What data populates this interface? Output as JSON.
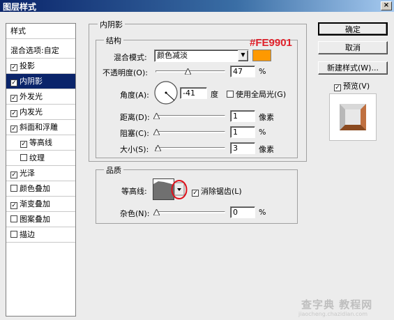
{
  "window": {
    "title": "图层样式",
    "close": "×"
  },
  "left_list": {
    "header": "样式",
    "items": [
      {
        "label": "混合选项:自定",
        "checkbox": false,
        "checked": false,
        "selected": false,
        "indent": false
      },
      {
        "label": "投影",
        "checkbox": true,
        "checked": true,
        "selected": false,
        "indent": false
      },
      {
        "label": "内阴影",
        "checkbox": true,
        "checked": true,
        "selected": true,
        "indent": false
      },
      {
        "label": "外发光",
        "checkbox": true,
        "checked": true,
        "selected": false,
        "indent": false
      },
      {
        "label": "内发光",
        "checkbox": true,
        "checked": true,
        "selected": false,
        "indent": false
      },
      {
        "label": "斜面和浮雕",
        "checkbox": true,
        "checked": true,
        "selected": false,
        "indent": false
      },
      {
        "label": "等高线",
        "checkbox": true,
        "checked": true,
        "selected": false,
        "indent": true
      },
      {
        "label": "纹理",
        "checkbox": true,
        "checked": false,
        "selected": false,
        "indent": true
      },
      {
        "label": "光泽",
        "checkbox": true,
        "checked": true,
        "selected": false,
        "indent": false
      },
      {
        "label": "颜色叠加",
        "checkbox": true,
        "checked": false,
        "selected": false,
        "indent": false
      },
      {
        "label": "渐变叠加",
        "checkbox": true,
        "checked": true,
        "selected": false,
        "indent": false
      },
      {
        "label": "图案叠加",
        "checkbox": true,
        "checked": false,
        "selected": false,
        "indent": false
      },
      {
        "label": "描边",
        "checkbox": true,
        "checked": false,
        "selected": false,
        "indent": false
      }
    ]
  },
  "panel": {
    "title": "内阴影",
    "structure": {
      "title": "结构",
      "annotation": "#FE9901",
      "blend_mode_label": "混合模式:",
      "blend_mode_value": "颜色减淡",
      "swatch_color": "#FE9901",
      "opacity_label": "不透明度(O):",
      "opacity_value": "47",
      "opacity_unit": "%",
      "angle_label": "角度(A):",
      "angle_value": "-41",
      "angle_unit": "度",
      "global_light_label": "使用全局光(G)",
      "global_light_checked": false,
      "distance_label": "距离(D):",
      "distance_value": "1",
      "distance_unit": "像素",
      "choke_label": "阻塞(C):",
      "choke_value": "1",
      "choke_unit": "%",
      "size_label": "大小(S):",
      "size_value": "3",
      "size_unit": "像素"
    },
    "quality": {
      "title": "品质",
      "contour_label": "等高线:",
      "antialias_label": "消除锯齿(L)",
      "antialias_checked": true,
      "noise_label": "杂色(N):",
      "noise_value": "0",
      "noise_unit": "%"
    }
  },
  "buttons": {
    "ok": "确定",
    "cancel": "取消",
    "new_style": "新建样式(W)...",
    "preview_label": "预览(V)",
    "preview_checked": true
  },
  "watermark": {
    "line1": "查字典 教程网",
    "line2": "jiaocheng.chazidian.com"
  }
}
